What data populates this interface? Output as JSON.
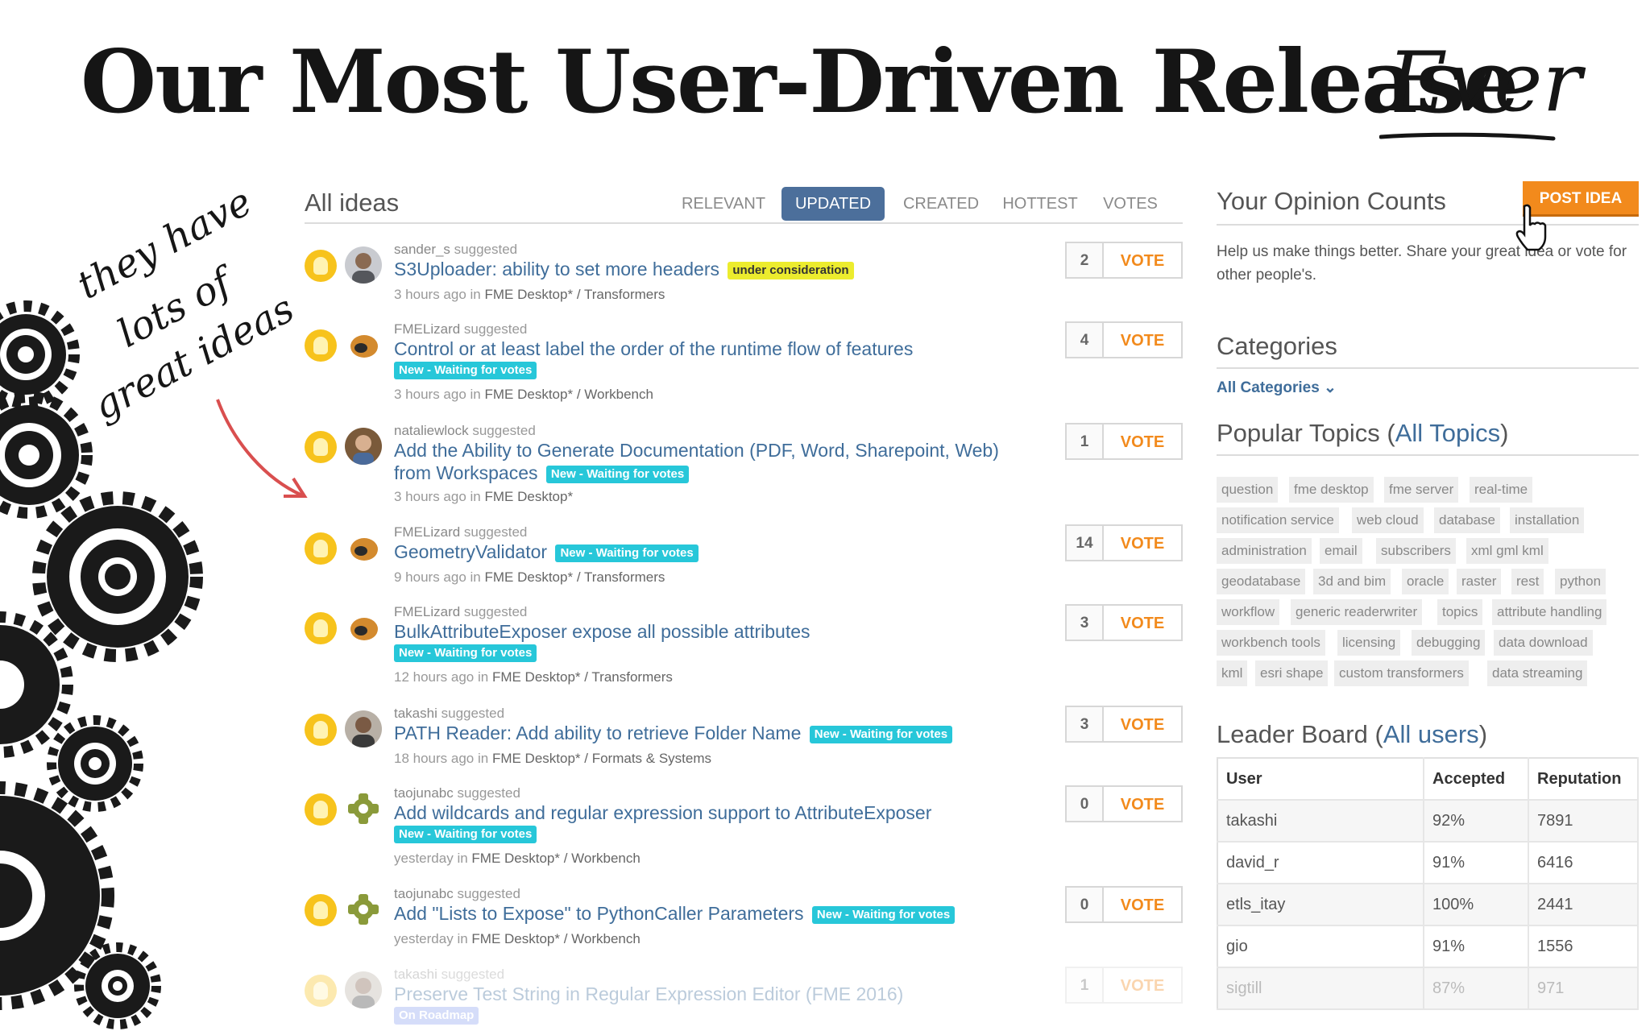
{
  "slide": {
    "title_main": "Our Most User-Driven Release",
    "title_accent": "Ever",
    "annotation": [
      "they have",
      "lots of",
      "great ideas"
    ]
  },
  "ideas": {
    "title": "All ideas",
    "tabs": [
      {
        "label": "RELEVANT",
        "active": false
      },
      {
        "label": "UPDATED",
        "active": true
      },
      {
        "label": "CREATED",
        "active": false
      },
      {
        "label": "HOTTEST",
        "active": false
      },
      {
        "label": "VOTES",
        "active": false
      }
    ],
    "vote_label": "VOTE",
    "suggested_word": "suggested",
    "in_word": "in",
    "items": [
      {
        "user": "sander_s",
        "title": "S3Uploader: ability to set more headers",
        "badge": "under consideration",
        "time": "3 hours ago",
        "product": "FME Desktop*",
        "category": "Transformers",
        "votes": "2"
      },
      {
        "user": "FMELizard",
        "title": "Control or at least label the order of the runtime flow of features",
        "badge": "New - Waiting for votes",
        "time": "3 hours ago",
        "product": "FME Desktop*",
        "category": "Workbench",
        "votes": "4"
      },
      {
        "user": "nataliewlock",
        "title": "Add the Ability to Generate Documentation (PDF, Word, Sharepoint, Web) from Workspaces",
        "badge": "New - Waiting for votes",
        "time": "3 hours ago",
        "product": "FME Desktop*",
        "category": "",
        "votes": "1"
      },
      {
        "user": "FMELizard",
        "title": "GeometryValidator",
        "badge": "New - Waiting for votes",
        "time": "9 hours ago",
        "product": "FME Desktop*",
        "category": "Transformers",
        "votes": "14"
      },
      {
        "user": "FMELizard",
        "title": "BulkAttributeExposer expose all possible attributes",
        "badge": "New - Waiting for votes",
        "time": "12 hours ago",
        "product": "FME Desktop*",
        "category": "Transformers",
        "votes": "3"
      },
      {
        "user": "takashi",
        "title": "PATH Reader: Add ability to retrieve Folder Name",
        "badge": "New - Waiting for votes",
        "time": "18 hours ago",
        "product": "FME Desktop*",
        "category": "Formats & Systems",
        "votes": "3"
      },
      {
        "user": "taojunabc",
        "title": "Add wildcards and regular expression support to AttributeExposer",
        "badge": "New - Waiting for votes",
        "time": "yesterday",
        "product": "FME Desktop*",
        "category": "Workbench",
        "votes": "0"
      },
      {
        "user": "taojunabc",
        "title": "Add \"Lists to Expose\" to PythonCaller Parameters",
        "badge": "New - Waiting for votes",
        "time": "yesterday",
        "product": "FME Desktop*",
        "category": "Workbench",
        "votes": "0"
      },
      {
        "user": "takashi",
        "title": "Preserve Test String in Regular Expression Editor (FME 2016)",
        "badge": "On Roadmap",
        "time": "",
        "product": "",
        "category": "",
        "votes": "1"
      }
    ]
  },
  "sidebar": {
    "opinion_title": "Your Opinion Counts",
    "post_button": "POST IDEA",
    "opinion_text": "Help us make things better. Share your great idea or vote for other people's.",
    "categories_title": "Categories",
    "categories_link": "All Categories",
    "topics_title": "Popular Topics",
    "topics_link": "All Topics",
    "topics": [
      "question",
      "fme desktop",
      "fme server",
      "real-time",
      "notification service",
      "web cloud",
      "database",
      "installation",
      "administration",
      "email",
      "subscribers",
      "xml gml kml",
      "geodatabase",
      "3d and bim",
      "oracle",
      "raster",
      "rest",
      "python",
      "workflow",
      "generic readerwriter",
      "topics",
      "attribute handling",
      "workbench tools",
      "licensing",
      "debugging",
      "data download",
      "kml",
      "esri shape",
      "custom transformers",
      "data streaming"
    ],
    "leader_title": "Leader Board",
    "leader_link": "All users",
    "leader_columns": [
      "User",
      "Accepted",
      "Reputation"
    ],
    "leader_rows": [
      [
        "takashi",
        "92%",
        "7891"
      ],
      [
        "david_r",
        "91%",
        "6416"
      ],
      [
        "etls_itay",
        "100%",
        "2441"
      ],
      [
        "gio",
        "91%",
        "1556"
      ],
      [
        "sigtill",
        "87%",
        "971"
      ]
    ]
  },
  "colors": {
    "accent_blue": "#4c6f9b",
    "link_blue": "#3f6d9a",
    "vote_orange": "#f28a1c",
    "badge_cyan": "#27c7d9",
    "badge_yellow": "#ecec2e",
    "bulb_yellow": "#f7c31c"
  }
}
